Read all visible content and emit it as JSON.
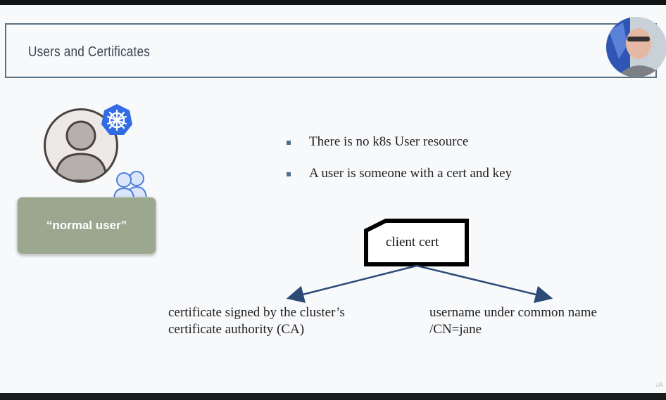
{
  "slide": {
    "title": "Users and Certificates",
    "role_label": "“normal user”",
    "bullets": [
      "There is no k8s User resource",
      "A user is someone with a cert and key"
    ],
    "cert_label": "client cert",
    "left_note": {
      "line1": "certificate signed by the cluster’s",
      "line2": "certificate authority (CA)"
    },
    "right_note": {
      "line1": "username under common name",
      "line2": "/CN=jane"
    },
    "watermark": "/A"
  },
  "colors": {
    "title_border": "#5b7385",
    "role_box": "#9ca790",
    "k8s_blue": "#326ce5",
    "arrow": "#2c4a77"
  }
}
